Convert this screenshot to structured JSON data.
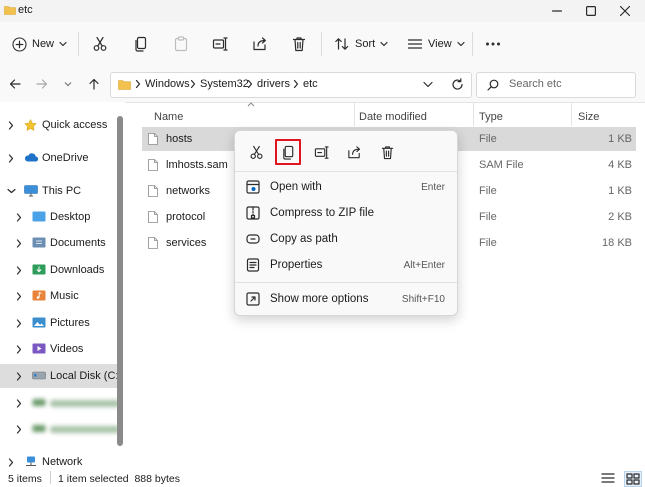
{
  "window": {
    "title": "etc"
  },
  "toolbar": {
    "new_label": "New",
    "sort_label": "Sort",
    "view_label": "View"
  },
  "address": {
    "crumbs": [
      "Windows",
      "System32",
      "drivers",
      "etc"
    ],
    "search_placeholder": "Search etc"
  },
  "sidebar": {
    "quick_access": "Quick access",
    "onedrive": "OneDrive",
    "this_pc": "This PC",
    "desktop": "Desktop",
    "documents": "Documents",
    "downloads": "Downloads",
    "music": "Music",
    "pictures": "Pictures",
    "videos": "Videos",
    "local_disk": "Local Disk (C:)",
    "network": "Network"
  },
  "columns": {
    "name": "Name",
    "date": "Date modified",
    "type": "Type",
    "size": "Size"
  },
  "files": [
    {
      "name": "hosts",
      "type": "File",
      "size": "1 KB"
    },
    {
      "name": "lmhosts.sam",
      "type": "SAM File",
      "size": "4 KB"
    },
    {
      "name": "networks",
      "type": "File",
      "size": "1 KB"
    },
    {
      "name": "protocol",
      "type": "File",
      "size": "2 KB"
    },
    {
      "name": "services",
      "type": "File",
      "size": "18 KB"
    }
  ],
  "context_menu": {
    "open_with": "Open with",
    "open_with_key": "Enter",
    "compress": "Compress to ZIP file",
    "copy_path": "Copy as path",
    "properties": "Properties",
    "properties_key": "Alt+Enter",
    "more_options": "Show more options",
    "more_options_key": "Shift+F10"
  },
  "status": {
    "items": "5 items",
    "selected": "1 item selected  888 bytes"
  },
  "colors": {
    "selected_row": "#d9d9d9",
    "folder": "#f2c14e",
    "highlight_border": "#e0141e",
    "accent": "#0067c0"
  }
}
